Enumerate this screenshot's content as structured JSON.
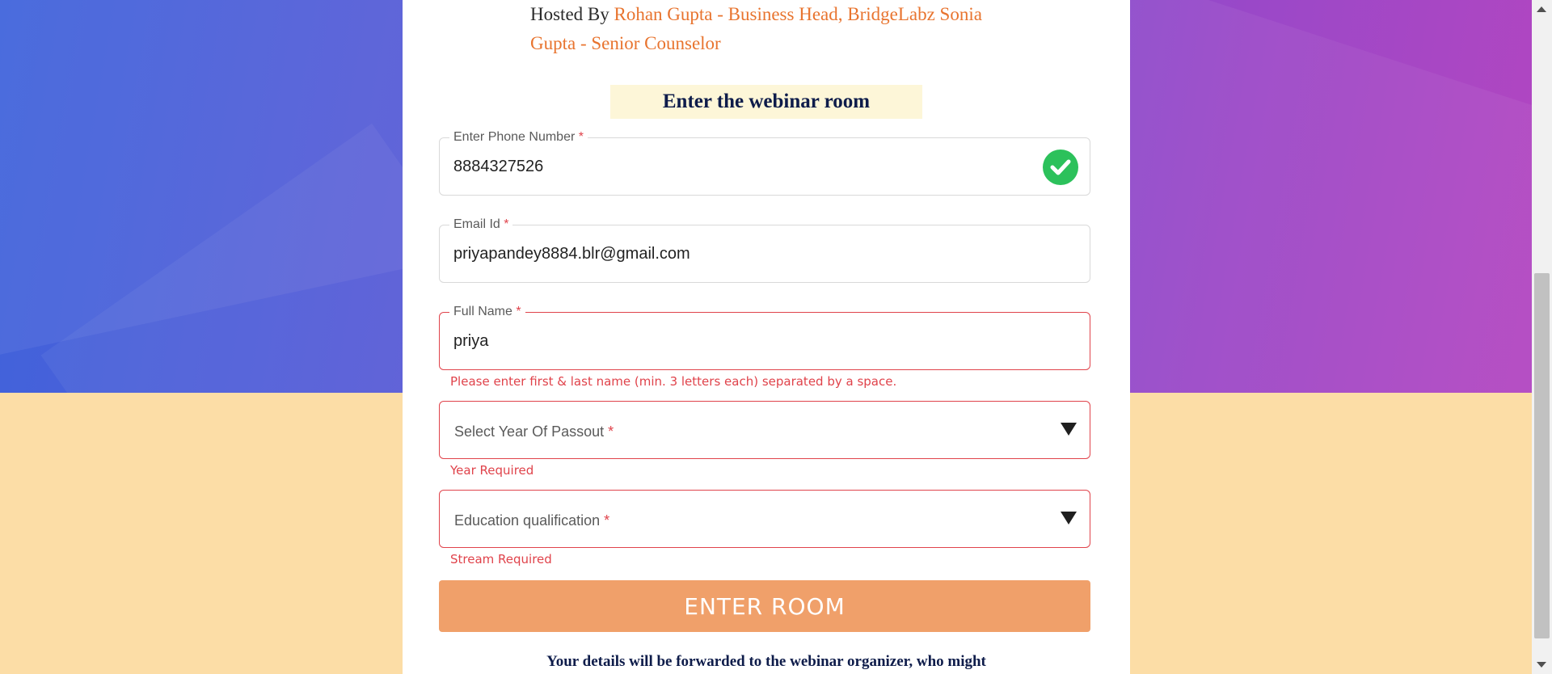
{
  "header": {
    "hosted_prefix": "Hosted By ",
    "hosts": "Rohan Gupta - Business Head, BridgeLabz Sonia Gupta - Senior Counselor"
  },
  "room_title": "Enter the webinar room",
  "form": {
    "phone": {
      "label": "Enter Phone Number",
      "required_mark": "*",
      "value": "8884327526",
      "valid_icon": "check-circle-icon"
    },
    "email": {
      "label": "Email Id",
      "required_mark": "*",
      "value": "priyapandey8884.blr@gmail.com"
    },
    "full_name": {
      "label": "Full Name",
      "required_mark": "*",
      "value": "priya",
      "error": "Please enter first & last name (min. 3 letters each) separated by a space."
    },
    "year_of_passout": {
      "placeholder": "Select Year Of Passout",
      "required_mark": "*",
      "error": "Year Required",
      "icon": "caret-down-icon"
    },
    "education": {
      "placeholder": "Education qualification",
      "required_mark": "*",
      "error": "Stream Required",
      "icon": "caret-down-icon"
    }
  },
  "enter_button": "ENTER ROOM",
  "footer_note": "Your details will be forwarded to the webinar organizer, who might",
  "colors": {
    "accent": "#e8742f",
    "button": "#f0a06a",
    "error": "#e0434b",
    "success": "#2cc15b",
    "title_bg": "#fdf6d8"
  }
}
